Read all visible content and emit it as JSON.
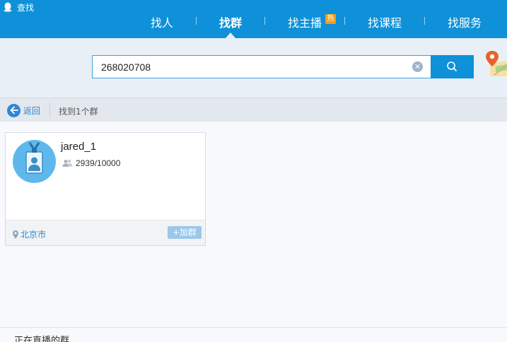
{
  "app": {
    "title": "查找"
  },
  "nav": {
    "items": [
      {
        "label": "找人",
        "active": false
      },
      {
        "label": "找群",
        "active": true
      },
      {
        "label": "找主播",
        "active": false,
        "badge": "热"
      },
      {
        "label": "找课程",
        "active": false
      },
      {
        "label": "找服务",
        "active": false
      }
    ]
  },
  "search": {
    "value": "268020708",
    "clear_icon": "clear-icon",
    "submit_icon": "search-icon"
  },
  "results": {
    "back_label": "返回",
    "summary": "找到1个群"
  },
  "group_card": {
    "name": "jared_1",
    "members": "2939/10000",
    "location": "北京市",
    "join_label": "+加群"
  },
  "section": {
    "title": "正在直播的群"
  },
  "colors": {
    "accent": "#0e91d8",
    "badge": "#f59c1a",
    "link": "#2f86d3",
    "join_button": "#9cc7ea"
  }
}
